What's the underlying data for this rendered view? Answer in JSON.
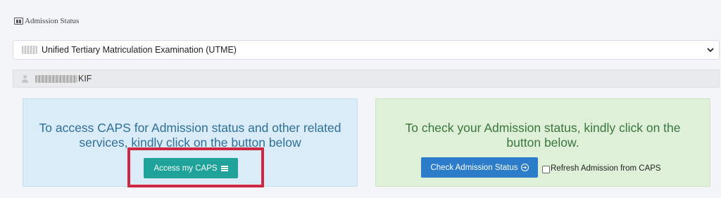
{
  "header": {
    "title": "Admission Status",
    "icon": "id-card-icon"
  },
  "exam_select": {
    "selected": "Unified Tertiary Matriculation Examination (UTME)"
  },
  "candidate": {
    "name_suffix": "KIF"
  },
  "caps_panel": {
    "message": "To access CAPS for Admission status and other related services, kindly click on the button below",
    "button_label": "Access my CAPS",
    "highlight_color": "#d12743"
  },
  "status_panel": {
    "message": "To check your Admission status, kindly click on the button below.",
    "button_label": "Check Admission Status",
    "refresh_label": "Refresh Admission from CAPS"
  },
  "colors": {
    "caps_button": "#1fa29a",
    "check_button": "#2c7dc9",
    "blue_panel": "#d9ecf8",
    "green_panel": "#dff0d8"
  }
}
